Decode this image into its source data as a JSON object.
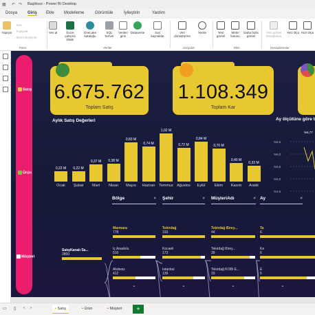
{
  "window": {
    "title": "Başlıksız - Power BI Desktop"
  },
  "menu": [
    "Dosya",
    "Giriş",
    "Ekle",
    "Modelleme",
    "Görüntüle",
    "İyileştirin",
    "Yardım"
  ],
  "ribbon": {
    "paste": "Yapıştır",
    "clipboard_small": [
      "Kes",
      "Kopyala",
      "Biçim Boyacısı"
    ],
    "clipboard_group": "Pano",
    "data_buttons": [
      "Veri al",
      "Excel çalışma kitabı",
      "OneLake kataloğu",
      "SQL Server",
      "Verileri girin",
      "Dataverse",
      "Son kaynaklar"
    ],
    "data_group": "Veriler",
    "query_buttons": [
      "Veri dönüştürme",
      "Yenile"
    ],
    "query_group": "Sorgular",
    "insert_buttons": [
      "Yeni görsel",
      "Metin kutusu",
      "Daha fazla görsel"
    ],
    "insert_group": "Ekle",
    "calc_buttons": [
      "Yeni görsel hesaplama",
      "Yeni ölçü",
      "Hızlı ölçü"
    ],
    "calc_group": "Hesaplamalar"
  },
  "nav": {
    "items": [
      "Satış",
      "Ürün",
      "Müşteri"
    ]
  },
  "cards": [
    {
      "value": "6.675.762",
      "label": "Toplam Satış"
    },
    {
      "value": "1.108.349",
      "label": "Toplam Kar"
    }
  ],
  "chart_data": {
    "type": "bar",
    "title": "Aylık Satış Değerleri",
    "categories": [
      "Ocak",
      "Şubat",
      "Mart",
      "Nisan",
      "Mayıs",
      "Haziran",
      "Temmuz",
      "Ağustos",
      "Eylül",
      "Ekim",
      "Kasım",
      "Aralık"
    ],
    "values": [
      0.22,
      0.22,
      0.37,
      0.38,
      0.83,
      0.74,
      1.02,
      0.72,
      0.84,
      0.7,
      0.4,
      0.33
    ],
    "value_labels": [
      "0,22 M",
      "0,22 M",
      "0,37 M",
      "0,38 M",
      "0,83 M",
      "0,74 M",
      "1,02 M",
      "0,72 M",
      "0,84 M",
      "0,70 M",
      "0,40 M",
      "0,33 M"
    ]
  },
  "line_title": "Ay ölçütüne göre t",
  "line_labels": [
    "%6,77",
    "%6,5",
    "%6,0",
    "%5,5",
    "%5,0",
    "%4,5"
  ],
  "decomp": {
    "headers": [
      "Bölge",
      "Şehir",
      "MüşteriAdı",
      "Ay"
    ],
    "close": "×",
    "root": {
      "name": "SatışKanalı Sa...",
      "value": "2800"
    },
    "regions": [
      {
        "name": "Marmara",
        "value": "778",
        "pct": 1.0
      },
      {
        "name": "İç Anadolu",
        "value": "510",
        "pct": 0.65
      },
      {
        "name": "Akdeniz",
        "value": "412",
        "pct": 0.53
      }
    ],
    "cities": [
      {
        "name": "Tekirdağ",
        "value": "193",
        "pct": 1.0
      },
      {
        "name": "Kocaeli",
        "value": "173",
        "pct": 0.9
      },
      {
        "name": "İstanbul",
        "value": "139",
        "pct": 0.72
      }
    ],
    "customers": [
      {
        "name": "Tekirdağ Birey...",
        "value": "44",
        "pct": 1.0
      },
      {
        "name": "Tekirdağ Birey...",
        "value": "39",
        "pct": 0.88
      },
      {
        "name": "Tekirdağ KOBİ E...",
        "value": "33",
        "pct": 0.75
      }
    ],
    "months": [
      {
        "name": "Ta",
        "value": "6"
      },
      {
        "name": "Ke",
        "value": "6"
      },
      {
        "name": "E",
        "value": "5"
      }
    ]
  },
  "tabs": [
    "Satış",
    "Ürün",
    "Müşteri"
  ],
  "add_tab": "+"
}
